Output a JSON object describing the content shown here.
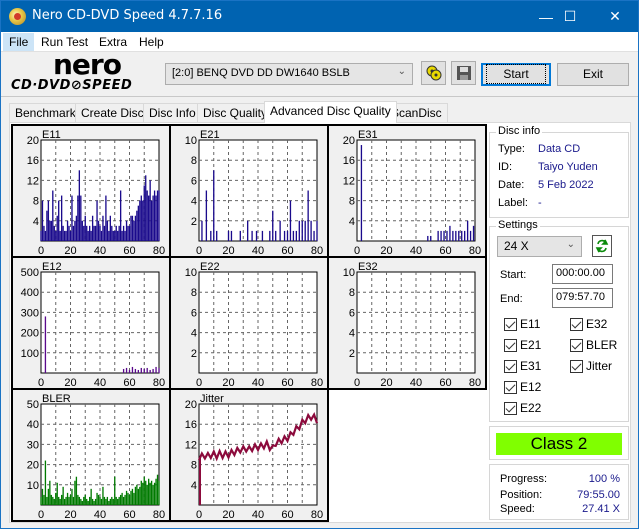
{
  "window": {
    "title": "Nero CD-DVD Speed 4.7.7.16",
    "controls": {
      "minimize": "—",
      "maximize": "☐",
      "close": "✕"
    }
  },
  "menu": [
    {
      "label": "File",
      "mnemonic": "F"
    },
    {
      "label": "Run Test",
      "mnemonic": "R"
    },
    {
      "label": "Extra",
      "mnemonic": "E"
    },
    {
      "label": "Help",
      "mnemonic": "H"
    }
  ],
  "toolbar": {
    "logo_top": "nero",
    "logo_bottom": "CD·DVD⊘SPEED",
    "drive": "[2:0]  BENQ DVD DD DW1640 BSLB",
    "start_label": "Start",
    "exit_label": "Exit"
  },
  "tabs": [
    {
      "label": "Benchmark",
      "active": false
    },
    {
      "label": "Create Disc",
      "active": false
    },
    {
      "label": "Disc Info",
      "active": false
    },
    {
      "label": "Disc Quality",
      "active": false
    },
    {
      "label": "Advanced Disc Quality",
      "active": true
    },
    {
      "label": "ScanDisc",
      "active": false
    }
  ],
  "disc_info": {
    "legend": "Disc info",
    "rows": [
      {
        "key": "Type:",
        "value": "Data CD"
      },
      {
        "key": "ID:",
        "value": "Taiyo Yuden"
      },
      {
        "key": "Date:",
        "value": "5 Feb 2022"
      },
      {
        "key": "Label:",
        "value": "-"
      }
    ]
  },
  "settings": {
    "legend": "Settings",
    "speed": "24 X",
    "start_label": "Start:",
    "start_value": "000:00.00",
    "end_label": "End:",
    "end_value": "079:57.70",
    "checkboxes": [
      {
        "label": "E11",
        "checked": true
      },
      {
        "label": "E21",
        "checked": true
      },
      {
        "label": "E31",
        "checked": true
      },
      {
        "label": "E12",
        "checked": true
      },
      {
        "label": "E22",
        "checked": true
      },
      {
        "label": "E32",
        "checked": true
      },
      {
        "label": "BLER",
        "checked": true
      },
      {
        "label": "Jitter",
        "checked": true
      }
    ]
  },
  "result": {
    "class_label": "Class 2",
    "class_color": "#80ff00"
  },
  "status": {
    "progress_label": "Progress:",
    "progress_value": "100 %",
    "position_label": "Position:",
    "position_value": "79:55.00",
    "speed_label": "Speed:",
    "speed_value": "27.41 X"
  },
  "chart_data": [
    {
      "type": "bar",
      "title": "E11",
      "color": "#1a0a8c",
      "x": [
        0,
        1,
        2,
        3,
        4,
        5,
        6,
        7,
        8,
        9,
        10,
        11,
        12,
        13,
        14,
        15,
        16,
        17,
        18,
        19,
        20,
        21,
        22,
        23,
        24,
        25,
        26,
        27,
        28,
        29,
        30,
        31,
        32,
        33,
        34,
        35,
        36,
        37,
        38,
        39,
        40,
        41,
        42,
        43,
        44,
        45,
        46,
        47,
        48,
        49,
        50,
        51,
        52,
        53,
        54,
        55,
        56,
        57,
        58,
        59,
        60,
        61,
        62,
        63,
        64,
        65,
        66,
        67,
        68,
        69,
        70,
        71,
        72,
        73,
        74,
        75,
        76,
        77,
        78,
        79,
        80
      ],
      "values": [
        2,
        8,
        3,
        2,
        6,
        8,
        4,
        4,
        10,
        3,
        2,
        5,
        8,
        2,
        9,
        3,
        2,
        2,
        4,
        3,
        2,
        9,
        3,
        4,
        5,
        9,
        14,
        9,
        4,
        3,
        5,
        3,
        2,
        3,
        2,
        5,
        3,
        3,
        8,
        4,
        3,
        2,
        5,
        3,
        9,
        4,
        2,
        5,
        3,
        2,
        2,
        3,
        2,
        3,
        10,
        2,
        3,
        2,
        4,
        3,
        3,
        5,
        5,
        4,
        5,
        6,
        7,
        8,
        9,
        8,
        11,
        13,
        10,
        9,
        12,
        8,
        9,
        10,
        9,
        10,
        10
      ],
      "xlim": [
        0,
        80
      ],
      "ylim": [
        0,
        20
      ],
      "xticks": [
        0,
        20,
        40,
        60,
        80
      ],
      "yticks": [
        4,
        8,
        12,
        16,
        20
      ]
    },
    {
      "type": "bar",
      "title": "E21",
      "color": "#1a0a8c",
      "x": [
        2,
        5,
        8,
        10,
        12,
        20,
        22,
        28,
        33,
        36,
        39,
        43,
        48,
        50,
        52,
        55,
        58,
        60,
        62,
        64,
        66,
        68,
        70,
        72,
        74,
        76,
        78,
        80
      ],
      "values": [
        2,
        5,
        1,
        7,
        1,
        1,
        1,
        1,
        2,
        1,
        1,
        1,
        1,
        3,
        1,
        2,
        1,
        1,
        4,
        1,
        1,
        2,
        2,
        2,
        5,
        2,
        1,
        2
      ],
      "xlim": [
        0,
        80
      ],
      "ylim": [
        0,
        10
      ],
      "xticks": [
        0,
        20,
        40,
        60,
        80
      ],
      "yticks": [
        2,
        4,
        6,
        8,
        10
      ]
    },
    {
      "type": "bar",
      "title": "E31",
      "color": "#1a0a8c",
      "x": [
        3,
        48,
        50,
        55,
        57,
        59,
        61,
        63,
        65,
        67,
        69,
        71,
        73,
        75,
        77,
        79
      ],
      "values": [
        19,
        1,
        1,
        2,
        2,
        2,
        2,
        3,
        2,
        2,
        2,
        2,
        2,
        4,
        2,
        3
      ],
      "xlim": [
        0,
        80
      ],
      "ylim": [
        0,
        20
      ],
      "xticks": [
        0,
        20,
        40,
        60,
        80
      ],
      "yticks": [
        4,
        8,
        12,
        16,
        20
      ]
    },
    {
      "type": "bar",
      "title": "E12",
      "color": "#5a0a8c",
      "x": [
        3,
        56,
        58,
        60,
        62,
        64,
        66,
        68,
        70,
        72,
        74,
        76,
        78,
        80
      ],
      "values": [
        280,
        20,
        25,
        15,
        30,
        20,
        15,
        25,
        20,
        25,
        15,
        20,
        30,
        25
      ],
      "xlim": [
        0,
        80
      ],
      "ylim": [
        0,
        500
      ],
      "xticks": [
        0,
        20,
        40,
        60,
        80
      ],
      "yticks": [
        100,
        200,
        300,
        400,
        500
      ]
    },
    {
      "type": "bar",
      "title": "E22",
      "color": "#1a0a8c",
      "x": [],
      "values": [],
      "xlim": [
        0,
        80
      ],
      "ylim": [
        0,
        10
      ],
      "xticks": [
        0,
        20,
        40,
        60,
        80
      ],
      "yticks": [
        2,
        4,
        6,
        8,
        10
      ]
    },
    {
      "type": "bar",
      "title": "E32",
      "color": "#1a0a8c",
      "x": [],
      "values": [],
      "xlim": [
        0,
        80
      ],
      "ylim": [
        0,
        10
      ],
      "xticks": [
        0,
        20,
        40,
        60,
        80
      ],
      "yticks": [
        2,
        4,
        6,
        8,
        10
      ]
    },
    {
      "type": "bar",
      "title": "BLER",
      "color": "#007a00",
      "x": [
        0,
        1,
        2,
        3,
        4,
        5,
        6,
        7,
        8,
        9,
        10,
        11,
        12,
        13,
        14,
        15,
        16,
        17,
        18,
        19,
        20,
        21,
        22,
        23,
        24,
        25,
        26,
        27,
        28,
        29,
        30,
        31,
        32,
        33,
        34,
        35,
        36,
        37,
        38,
        39,
        40,
        41,
        42,
        43,
        44,
        45,
        46,
        47,
        48,
        49,
        50,
        51,
        52,
        53,
        54,
        55,
        56,
        57,
        58,
        59,
        60,
        61,
        62,
        63,
        64,
        65,
        66,
        67,
        68,
        69,
        70,
        71,
        72,
        73,
        74,
        75,
        76,
        77,
        78,
        79,
        80
      ],
      "values": [
        4,
        8,
        5,
        22,
        4,
        8,
        12,
        5,
        4,
        3,
        6,
        11,
        4,
        3,
        5,
        9,
        3,
        4,
        6,
        4,
        5,
        8,
        4,
        12,
        14,
        5,
        4,
        3,
        2,
        4,
        5,
        3,
        2,
        4,
        8,
        3,
        2,
        3,
        6,
        5,
        4,
        3,
        9,
        4,
        3,
        4,
        2,
        3,
        4,
        3,
        14,
        4,
        3,
        4,
        5,
        6,
        4,
        5,
        7,
        6,
        5,
        7,
        8,
        6,
        9,
        10,
        8,
        9,
        12,
        11,
        14,
        12,
        10,
        13,
        11,
        12,
        10,
        11,
        13,
        15,
        12
      ],
      "xlim": [
        0,
        80
      ],
      "ylim": [
        0,
        50
      ],
      "xticks": [
        0,
        20,
        40,
        60,
        80
      ],
      "yticks": [
        10,
        20,
        30,
        40,
        50
      ]
    },
    {
      "type": "line",
      "title": "Jitter",
      "color": "#8c0a3c",
      "x": [
        0,
        2,
        4,
        6,
        8,
        10,
        12,
        14,
        16,
        18,
        20,
        22,
        24,
        26,
        28,
        30,
        32,
        34,
        36,
        38,
        40,
        42,
        44,
        46,
        48,
        50,
        52,
        54,
        56,
        58,
        60,
        62,
        64,
        66,
        68,
        70,
        72,
        74,
        76,
        78,
        80
      ],
      "values": [
        9.5,
        9.6,
        9.8,
        9.7,
        9.9,
        10.0,
        9.8,
        10.1,
        9.9,
        10.0,
        10.0,
        10.3,
        10.5,
        10.7,
        11.0,
        11.0,
        11.2,
        11.0,
        11.3,
        11.4,
        11.5,
        11.6,
        11.8,
        12.0,
        11.5,
        11.2,
        12.3,
        12.5,
        12.8,
        13.0,
        13.3,
        13.8,
        14.5,
        15.0,
        15.6,
        16.3,
        16.8,
        17.2,
        17.5,
        17.3,
        16.8
      ],
      "xlim": [
        0,
        80
      ],
      "ylim": [
        0,
        20
      ],
      "xticks": [
        0,
        20,
        40,
        60,
        80
      ],
      "yticks": [
        4,
        8,
        12,
        16,
        20
      ]
    }
  ]
}
